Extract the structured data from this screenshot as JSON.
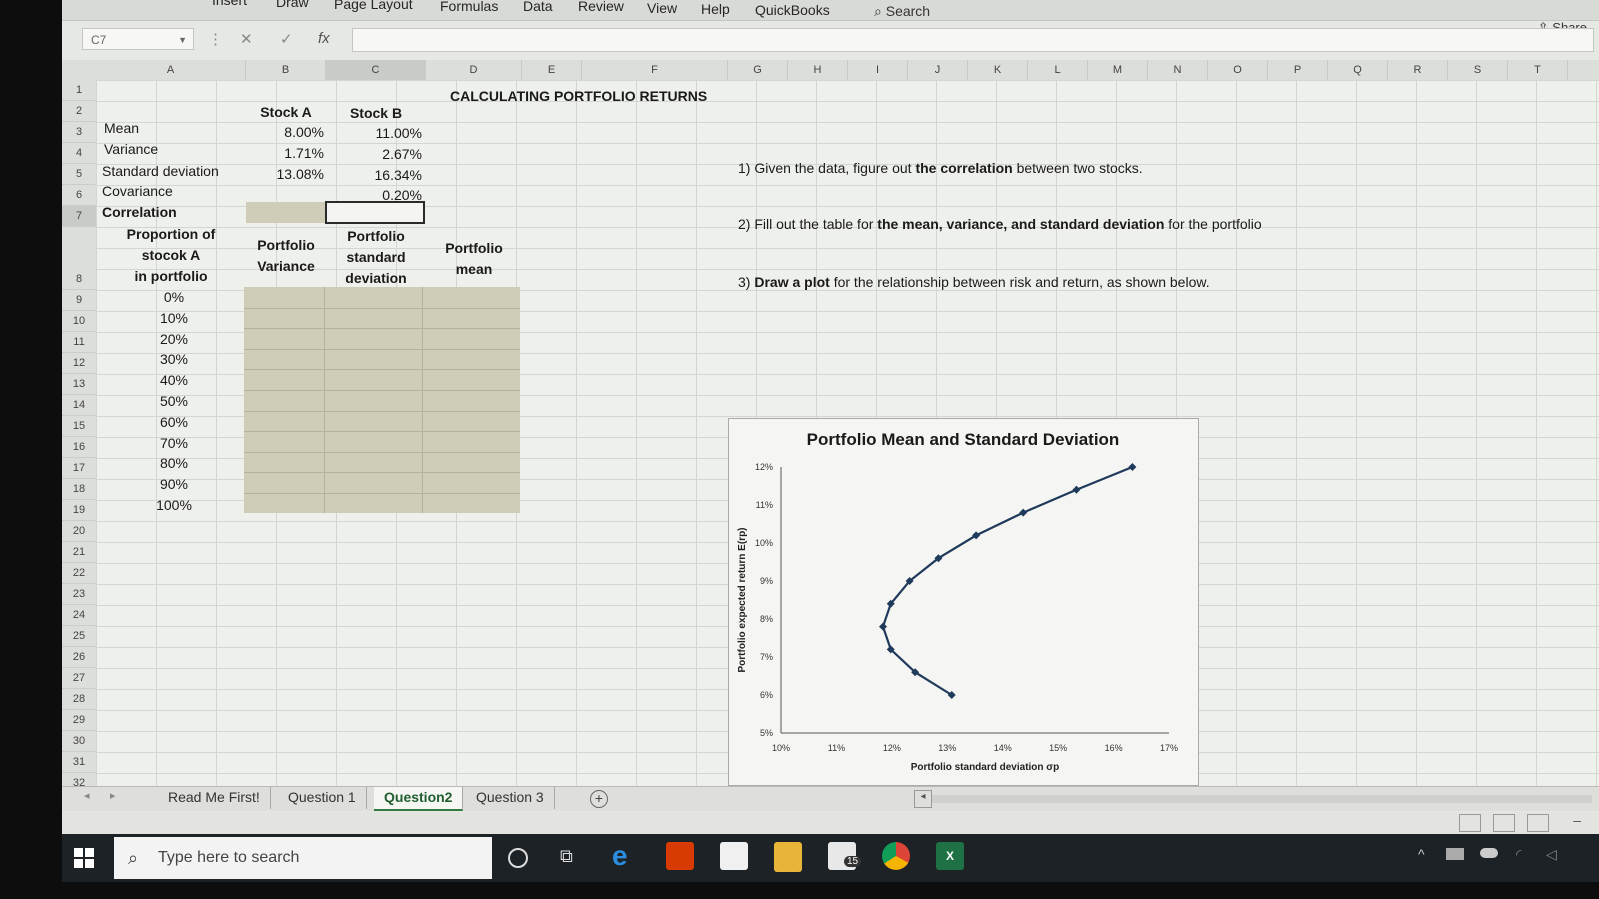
{
  "ribbon": {
    "menus": [
      "Insert",
      "Draw",
      "Page Layout",
      "Formulas",
      "Data",
      "Review",
      "View",
      "Help",
      "QuickBooks"
    ],
    "search": "Search",
    "share": "Share"
  },
  "formula_bar": {
    "name_box": "C7",
    "fx": "fx"
  },
  "columns": [
    "A",
    "B",
    "C",
    "D",
    "E",
    "F",
    "G",
    "H",
    "I",
    "J",
    "K",
    "L",
    "M",
    "N",
    "O",
    "P",
    "Q",
    "R",
    "S",
    "T"
  ],
  "rows": [
    "1",
    "2",
    "3",
    "4",
    "5",
    "6",
    "7",
    "8",
    "9",
    "10",
    "11",
    "12",
    "13",
    "14",
    "15",
    "16",
    "17",
    "18",
    "19",
    "20",
    "21",
    "22",
    "23",
    "24",
    "25",
    "26",
    "27",
    "28",
    "29",
    "30",
    "31",
    "32"
  ],
  "sheet": {
    "title": "CALCULATING PORTFOLIO RETURNS",
    "header_a": "Stock A",
    "header_b": "Stock B",
    "mean_label": "Mean",
    "mean_a": "8.00%",
    "mean_b": "11.00%",
    "var_label": "Variance",
    "var_a": "1.71%",
    "var_b": "2.67%",
    "sd_label": "Standard deviation",
    "sd_a": "13.08%",
    "sd_b": "16.34%",
    "cov_label": "Covariance",
    "cov_val": "0.20%",
    "corr_label": "Correlation",
    "col_prop_1": "Proportion of",
    "col_prop_2": "stocok A",
    "col_prop_3": "in portfolio",
    "col_pvar_1": "Portfolio",
    "col_pvar_2": "Variance",
    "col_psd_1": "Portfolio",
    "col_psd_2": "standard",
    "col_psd_3": "deviation",
    "col_pmean_1": "Portfolio",
    "col_pmean_2": "mean",
    "proportions": [
      "0%",
      "10%",
      "20%",
      "30%",
      "40%",
      "50%",
      "60%",
      "70%",
      "80%",
      "90%",
      "100%"
    ]
  },
  "instructions": {
    "q1_pre": "1) Given the data, figure out ",
    "q1_bold": "the correlation",
    "q1_post": " between two stocks.",
    "q2_pre": "2) Fill out the table for ",
    "q2_bold": "the mean, variance, and standard deviation",
    "q2_post": " for the portfolio",
    "q3_pre": "3) ",
    "q3_bold": "Draw a plot",
    "q3_post": " for the relationship between risk and return, as shown below."
  },
  "chart_data": {
    "type": "line",
    "title": "Portfolio Mean and Standard Deviation",
    "xlabel": "Portfolio standard deviation σp",
    "ylabel": "Portfolio expected return E(rp)",
    "xlim": [
      10,
      17
    ],
    "ylim": [
      5,
      12
    ],
    "xticks": [
      "10%",
      "11%",
      "12%",
      "13%",
      "14%",
      "15%",
      "16%",
      "17%"
    ],
    "yticks": [
      "5%",
      "6%",
      "7%",
      "8%",
      "9%",
      "10%",
      "11%",
      "12%"
    ],
    "x": [
      13.08,
      12.42,
      11.98,
      11.84,
      11.98,
      12.32,
      12.84,
      13.52,
      14.37,
      15.33,
      16.34
    ],
    "y": [
      6.0,
      6.6,
      7.2,
      7.8,
      8.4,
      9.0,
      9.6,
      10.2,
      10.8,
      11.4,
      12.0
    ],
    "marker": "diamond",
    "color": "#1f3a5a"
  },
  "tabs": [
    "Read Me First!",
    "Question 1",
    "Question2",
    "Question 3"
  ],
  "active_tab": "Question2",
  "taskbar": {
    "search_placeholder": "Type here to search",
    "mail_badge": "15"
  }
}
